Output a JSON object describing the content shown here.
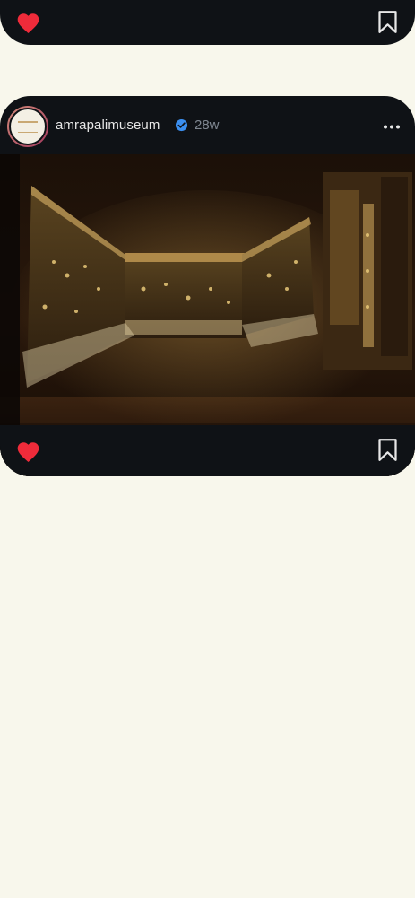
{
  "post": {
    "username": "amrapalimuseum",
    "time": "28w",
    "verified_icon": "verified-badge-icon",
    "more_icon": "more-options-icon",
    "image_icon": "museum-gallery-photo"
  },
  "actions": {
    "like_icon": "heart-icon",
    "save_icon": "bookmark-icon"
  },
  "colors": {
    "background": "#f8f7ec",
    "card": "#0f1216",
    "like": "#ef2b3a",
    "verified": "#3b8ff0"
  }
}
